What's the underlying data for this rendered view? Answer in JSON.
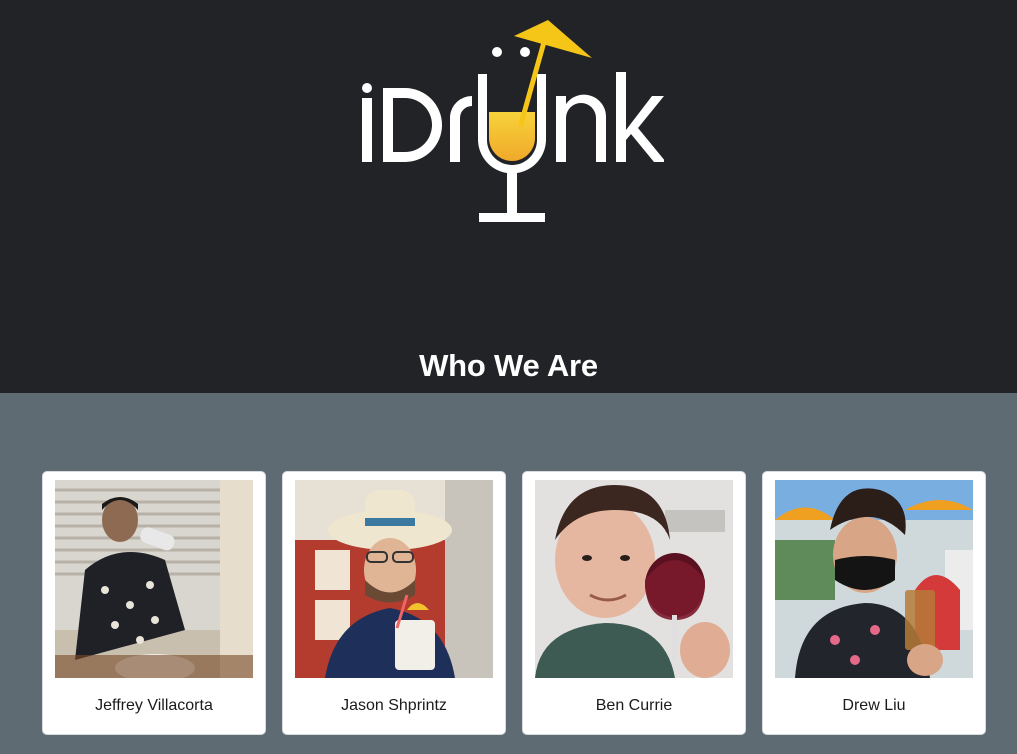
{
  "brand": {
    "logo_text": "iDrunk",
    "accent_color": "#f5c518"
  },
  "section": {
    "title": "Who We Are"
  },
  "team": [
    {
      "name": "Jeffrey Villacorta",
      "photo": "photo of person drinking from a can"
    },
    {
      "name": "Jason Shprintz",
      "photo": "photo of person in sun hat with tropical drink"
    },
    {
      "name": "Ben Currie",
      "photo": "photo of person raising a glass of red wine"
    },
    {
      "name": "Drew Liu",
      "photo": "photo of person in face mask holding iced drink"
    }
  ]
}
